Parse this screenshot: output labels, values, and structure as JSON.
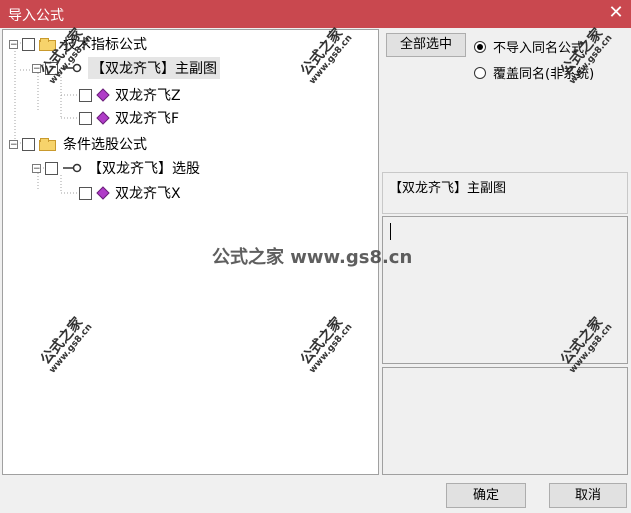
{
  "window": {
    "title": "导入公式",
    "close_glyph": "✕"
  },
  "tree": {
    "groups": [
      {
        "label": "技术指标公式",
        "expander": "−",
        "child": {
          "label": "【双龙齐飞】主副图",
          "expander": "−",
          "items": [
            {
              "label": "双龙齐飞Z"
            },
            {
              "label": "双龙齐飞F"
            }
          ]
        }
      },
      {
        "label": "条件选股公式",
        "expander": "−",
        "child": {
          "label": "【双龙齐飞】选股",
          "expander": "−",
          "items": [
            {
              "label": "双龙齐飞X"
            }
          ]
        }
      }
    ]
  },
  "right": {
    "select_all_label": "全部选中",
    "options": [
      {
        "label": "不导入同名公式",
        "selected": true
      },
      {
        "label": "覆盖同名(非系统)",
        "selected": false
      }
    ],
    "formula_name": "【双龙齐飞】主副图",
    "editor_text": "",
    "description_text": ""
  },
  "buttons": {
    "ok_label": "确定",
    "cancel_label": "取消"
  },
  "watermarks": {
    "stamp_big": "公式之家",
    "stamp_small": "www.gs8.cn",
    "center": "公式之家 www.gs8.cn"
  },
  "colors": {
    "titlebar": "#c9484f",
    "background": "#f0f0f0",
    "folder": "#f6d36b",
    "gem": "#b03cc8"
  }
}
